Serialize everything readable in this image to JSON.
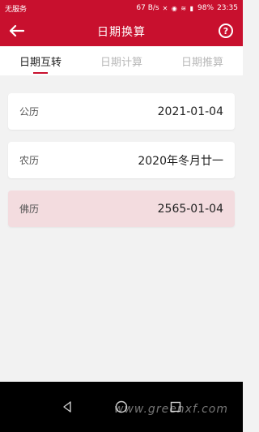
{
  "status_bar": {
    "carrier": "无服务",
    "speed": "67 B/s",
    "battery": "98%",
    "time": "23:35",
    "icons": [
      "mute-icon",
      "eye-icon",
      "wifi-icon",
      "battery-icon"
    ]
  },
  "app_bar": {
    "title": "日期换算",
    "help_label": "?"
  },
  "tabs": [
    {
      "label": "日期互转",
      "active": true
    },
    {
      "label": "日期计算",
      "active": false
    },
    {
      "label": "日期推算",
      "active": false
    }
  ],
  "cards": [
    {
      "label": "公历",
      "value": "2021-01-04",
      "selected": false
    },
    {
      "label": "农历",
      "value": "2020年冬月廿一",
      "selected": false
    },
    {
      "label": "佛历",
      "value": "2565-01-04",
      "selected": true
    }
  ],
  "watermark": "www.greenxf.com",
  "colors": {
    "accent": "#c8102e",
    "selected_card": "#f3dcdf",
    "background": "#f2f2f2"
  }
}
